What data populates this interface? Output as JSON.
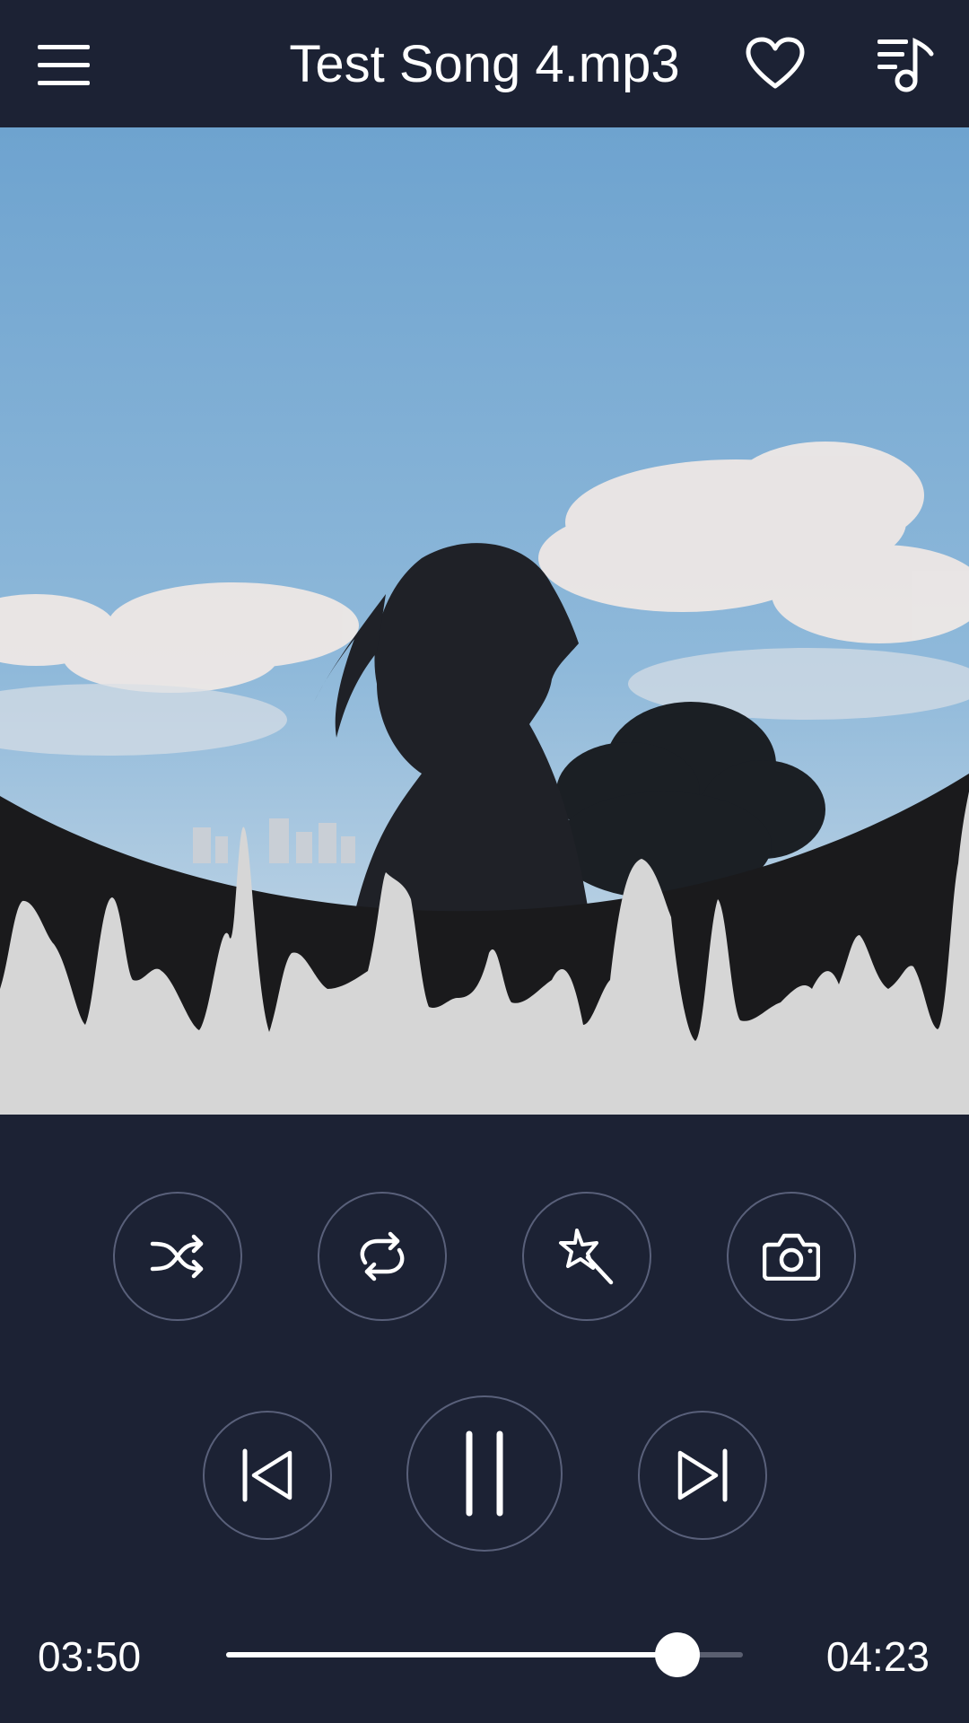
{
  "header": {
    "title": "Test Song 4.mp3",
    "menu_icon": "hamburger-menu-icon",
    "favorite_icon": "heart-icon",
    "playlist_icon": "music-playlist-icon"
  },
  "artwork": {
    "visualizer_icon": "waveform-visualizer"
  },
  "controls": {
    "shuffle_icon": "shuffle-icon",
    "repeat_icon": "repeat-icon",
    "effects_icon": "magic-wand-icon",
    "camera_icon": "camera-icon",
    "previous_icon": "skip-previous-icon",
    "pause_icon": "pause-icon",
    "next_icon": "skip-next-icon"
  },
  "progress": {
    "elapsed": "03:50",
    "total": "04:23",
    "fraction": 0.874
  },
  "colors": {
    "background": "#1c2234",
    "accent": "#ffffff",
    "ring": "#59607a"
  }
}
